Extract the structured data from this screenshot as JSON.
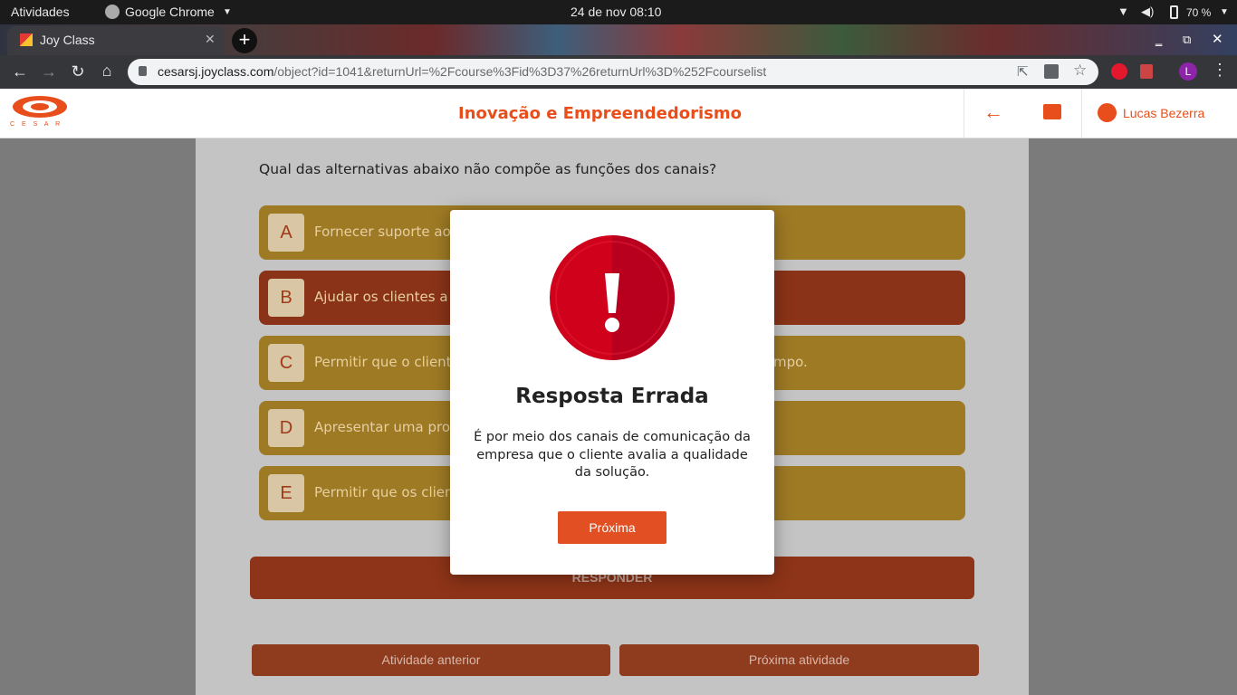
{
  "os_bar": {
    "activities": "Atividades",
    "app_name": "Google Chrome",
    "clock": "24 de nov  08:10",
    "battery": "70 %"
  },
  "browser": {
    "tab_title": "Joy Class",
    "url_host": "cesarsj.joyclass.com",
    "url_path": "/object?id=1041&returnUrl=%2Fcourse%3Fid%3D37%26returnUrl%3D%252Fcourselist",
    "profile_initial": "L"
  },
  "header": {
    "logo_text": "C E S A R",
    "course_title": "Inovação e Empreendedorismo",
    "user_name": "Lucas Bezerra"
  },
  "question": {
    "text": "Qual das alternativas abaixo não compõe as funções dos canais?",
    "options": [
      {
        "letter": "A",
        "text": "Fornecer suporte ao c"
      },
      {
        "letter": "B",
        "text": "Ajudar os clientes a av"
      },
      {
        "letter": "C",
        "text": "Permitir que o cliente",
        "tail": "mpo."
      },
      {
        "letter": "D",
        "text": "Apresentar uma prop"
      },
      {
        "letter": "E",
        "text": "Permitir que os client"
      }
    ],
    "answer_button": "RESPONDER"
  },
  "footer_nav": {
    "previous": "Atividade anterior",
    "next": "Próxima atividade"
  },
  "modal": {
    "title": "Resposta Errada",
    "message": "É por meio dos canais de comunicação da empresa que o cliente avalia a qualidade da solução.",
    "button": "Próxima"
  },
  "colors": {
    "brand": "#e84e1b",
    "option_normal": "#9e7a24",
    "option_selected": "#8b3318",
    "error_red": "#d0021b"
  }
}
